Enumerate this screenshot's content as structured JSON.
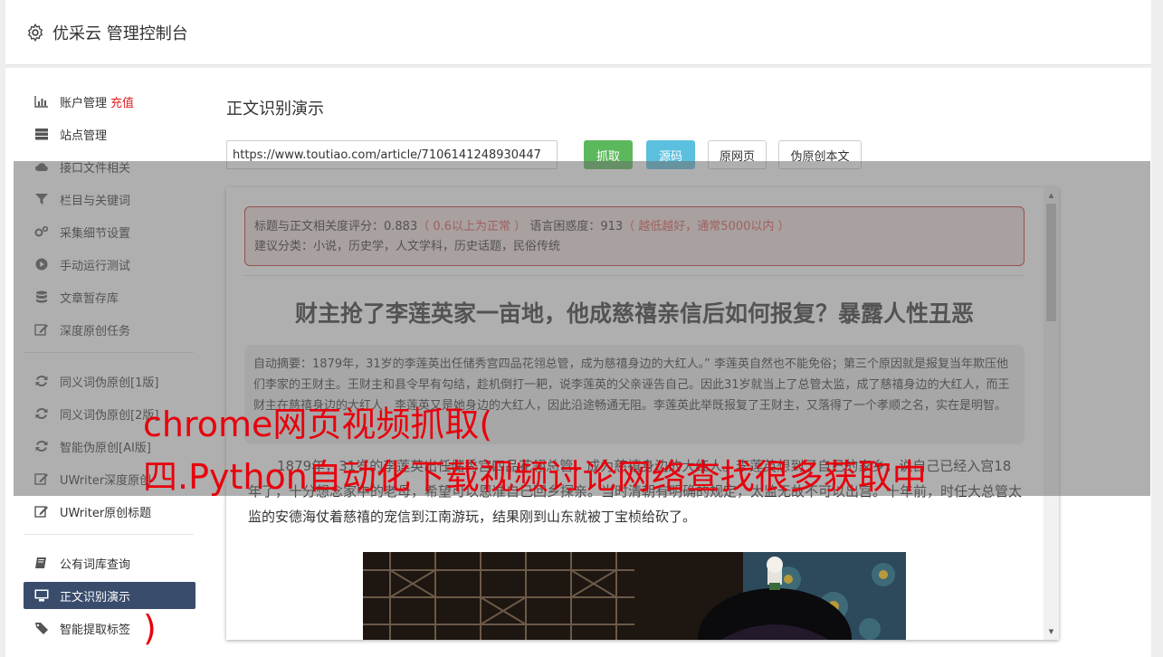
{
  "header": {
    "title": "优采云 管理控制台",
    "icon": "gear-icon"
  },
  "sidebar": {
    "group1": [
      {
        "label": "账户管理",
        "badge": "充值",
        "icon": "bar-chart-icon"
      },
      {
        "label": "站点管理",
        "icon": "server-icon"
      },
      {
        "label": "接口文件相关",
        "icon": "cloud-upload-icon"
      },
      {
        "label": "栏目与关键词",
        "icon": "filter-icon"
      },
      {
        "label": "采集细节设置",
        "icon": "gears-icon"
      },
      {
        "label": "手动运行测试",
        "icon": "play-circle-icon"
      },
      {
        "label": "文章暂存库",
        "icon": "database-icon"
      },
      {
        "label": "深度原创任务",
        "icon": "edit-icon"
      }
    ],
    "group2": [
      {
        "label": "同义词伪原创[1版]",
        "icon": "refresh-icon"
      },
      {
        "label": "同义词伪原创[2版]",
        "icon": "refresh-icon"
      },
      {
        "label": "智能伪原创[AI版]",
        "icon": "refresh-icon"
      },
      {
        "label": "UWriter深度原创",
        "icon": "edit-icon"
      },
      {
        "label": "UWriter原创标题",
        "icon": "edit-icon"
      }
    ],
    "group3": [
      {
        "label": "公有词库查询",
        "icon": "book-icon"
      },
      {
        "label": "正文识别演示",
        "icon": "desktop-icon",
        "active": true
      },
      {
        "label": "智能提取标签",
        "icon": "tag-icon"
      }
    ]
  },
  "main": {
    "title": "正文识别演示",
    "url_value": "https://www.toutiao.com/article/7106141248930447",
    "buttons": {
      "grab": "抓取",
      "source": "源码",
      "original": "原网页",
      "pseudo": "伪原创本文"
    }
  },
  "result": {
    "score_label": "标题与正文相关度评分：0.883",
    "score_note": "（ 0.6以上为正常 ）",
    "perplexity_label": "语言困惑度：913",
    "perplexity_note": "（ 越低越好，通常5000以内 ）",
    "categories": "建议分类：小说，历史学，人文学科，历史话题，民俗传统",
    "article_title": "财主抢了李莲英家一亩地，他成慈禧亲信后如何报复？暴露人性丑恶",
    "summary": "自动摘要：1879年，31岁的李莲英出任储秀宫四品花翎总管，成为慈禧身边的大红人。” 李莲英自然也不能免俗；第三个原因就是报复当年欺压他们李家的王财主。王财主和县令早有勾结，趁机倒打一耙，说李莲英的父亲诬告自己。因此31岁就当上了总管太监，成了慈禧身边的大红人，而王财主在慈禧身边的大红人，李莲英又是她身边的大红人，因此沿途畅通无阻。李莲英此举既报复了王财主，又落得了一个孝顺之名，实在是明智。",
    "body": "1879年，31岁的李莲英出任储秀宫四品花翎总管，成为慈禧身边的大红人。李莲英想到了自己的家乡，说自己已经入宫18年了，十分想念家中的老母，希望可以恩准自己回乡探亲。当时清朝有明确的规定，太监无故不可以出宫。十年前，时任大总管太监的安德海仗着慈禧的宠信到江南游玩，结果刚到山东就被丁宝桢给砍了。"
  },
  "watermark": {
    "line1": "chrome网页视频抓取(",
    "line2": "四.Python自动化下载视频讨论网络查找很多获取中",
    "line3": ")"
  }
}
